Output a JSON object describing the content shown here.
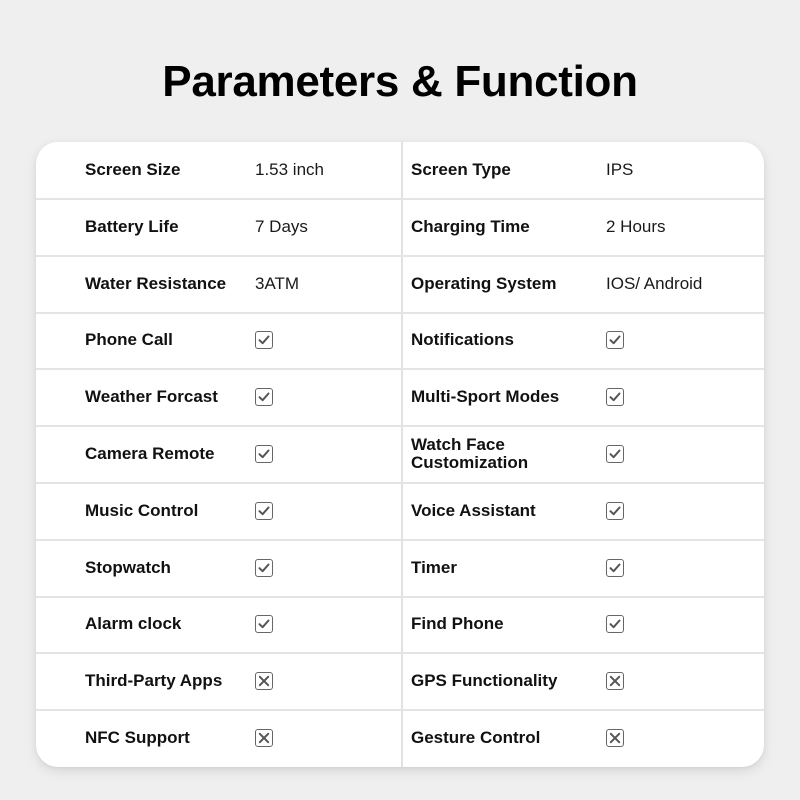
{
  "title": "Parameters & Function",
  "rows": [
    {
      "left": {
        "label": "Screen Size",
        "type": "text",
        "value": "1.53 inch"
      },
      "right": {
        "label": "Screen Type",
        "type": "text",
        "value": "IPS"
      }
    },
    {
      "left": {
        "label": "Battery Life",
        "type": "text",
        "value": "7 Days"
      },
      "right": {
        "label": "Charging Time",
        "type": "text",
        "value": "2 Hours"
      }
    },
    {
      "left": {
        "label": "Water Resistance",
        "type": "text",
        "value": "3ATM"
      },
      "right": {
        "label": "Operating System",
        "type": "text",
        "value": "IOS/ Android"
      }
    },
    {
      "left": {
        "label": "Phone Call",
        "type": "check",
        "value": true
      },
      "right": {
        "label": "Notifications",
        "type": "check",
        "value": true
      }
    },
    {
      "left": {
        "label": "Weather Forcast",
        "type": "check",
        "value": true
      },
      "right": {
        "label": "Multi-Sport Modes",
        "type": "check",
        "value": true
      }
    },
    {
      "left": {
        "label": "Camera Remote",
        "type": "check",
        "value": true
      },
      "right": {
        "label": "Watch Face Customization",
        "type": "check",
        "value": true
      }
    },
    {
      "left": {
        "label": "Music Control",
        "type": "check",
        "value": true
      },
      "right": {
        "label": "Voice Assistant",
        "type": "check",
        "value": true
      }
    },
    {
      "left": {
        "label": "Stopwatch",
        "type": "check",
        "value": true
      },
      "right": {
        "label": "Timer",
        "type": "check",
        "value": true
      }
    },
    {
      "left": {
        "label": "Alarm clock",
        "type": "check",
        "value": true
      },
      "right": {
        "label": "Find Phone",
        "type": "check",
        "value": true
      }
    },
    {
      "left": {
        "label": "Third-Party Apps",
        "type": "check",
        "value": false
      },
      "right": {
        "label": "GPS Functionality",
        "type": "check",
        "value": false
      }
    },
    {
      "left": {
        "label": "NFC Support",
        "type": "check",
        "value": false
      },
      "right": {
        "label": "Gesture Control",
        "type": "check",
        "value": false
      }
    }
  ],
  "icons": {
    "supported": "checkbox-checked-icon",
    "unsupported": "checkbox-x-icon"
  },
  "colors": {
    "background": "#efefef",
    "card": "#ffffff",
    "divider": "#e4e4e4",
    "icon_stroke": "#666666",
    "text": "#111111"
  }
}
